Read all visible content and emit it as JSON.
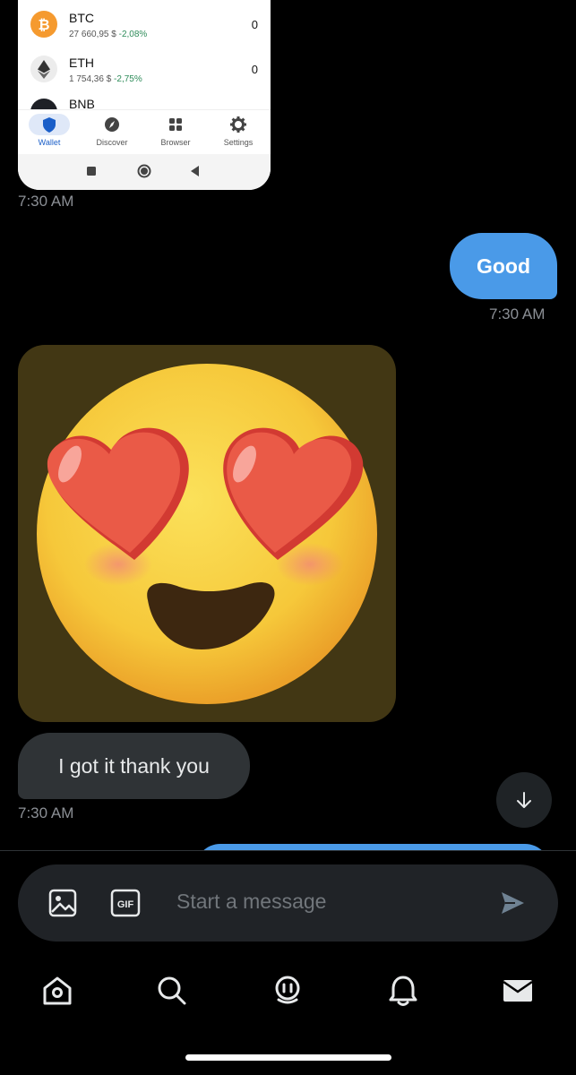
{
  "shared_screenshot": {
    "assets": [
      {
        "symbol": "BTC",
        "price": "27 660,95 $",
        "change": "-2,08%",
        "balance": "0",
        "color": "#f59a2f"
      },
      {
        "symbol": "ETH",
        "price": "1 754,36 $",
        "change": "-2,75%",
        "balance": "0",
        "color": "#ececec"
      },
      {
        "symbol": "BNB",
        "color": "#1e2026"
      }
    ],
    "nav": [
      {
        "label": "Wallet",
        "icon": "shield-icon"
      },
      {
        "label": "Discover",
        "icon": "compass-icon"
      },
      {
        "label": "Browser",
        "icon": "grid-icon"
      },
      {
        "label": "Settings",
        "icon": "gear-icon"
      }
    ]
  },
  "messages": {
    "screenshot_time": "7:30 AM",
    "outgoing_text": "Good",
    "outgoing_time": "7:30 AM",
    "incoming_text": "I got it thank you",
    "incoming_time": "7:30 AM"
  },
  "composer": {
    "placeholder": "Start a message",
    "gif_label": "GIF"
  },
  "tabs": [
    "home-icon",
    "search-icon",
    "spaces-icon",
    "notifications-icon",
    "messages-icon"
  ],
  "colors": {
    "accent": "#4a9ae8",
    "incoming_bubble": "#2f3336",
    "emoji_card_bg": "#423714"
  }
}
